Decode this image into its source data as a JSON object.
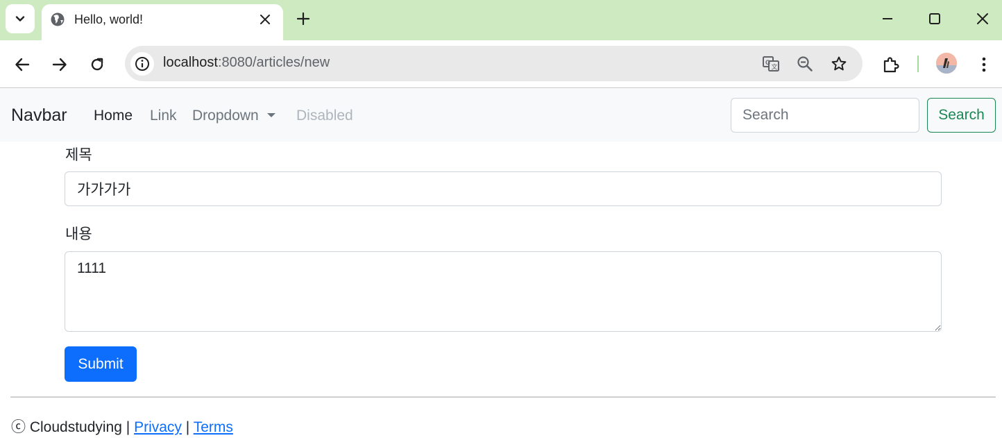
{
  "browser": {
    "tab": {
      "title": "Hello, world!"
    },
    "url": {
      "host": "localhost",
      "path": ":8080/articles/new"
    },
    "icons": [
      "tab-search-icon",
      "globe-icon",
      "close-icon",
      "plus-icon",
      "minimize-icon",
      "maximize-icon",
      "window-close-icon",
      "back-arrow-icon",
      "forward-arrow-icon",
      "reload-icon",
      "site-info-icon",
      "translate-icon",
      "zoom-out-icon",
      "bookmark-star-icon",
      "extensions-icon",
      "profile-avatar",
      "more-menu-icon"
    ]
  },
  "navbar": {
    "brand": "Navbar",
    "items": [
      {
        "label": "Home",
        "state": "active"
      },
      {
        "label": "Link",
        "state": "normal"
      },
      {
        "label": "Dropdown",
        "state": "dropdown"
      },
      {
        "label": "Disabled",
        "state": "disabled"
      }
    ],
    "search": {
      "placeholder": "Search",
      "button_label": "Search"
    }
  },
  "form": {
    "title_label": "제목",
    "title_value": "가가가가",
    "content_label": "내용",
    "content_value": "1111",
    "submit_label": "Submit"
  },
  "footer": {
    "copyright": "ⓒ Cloudstudying",
    "separator": "|",
    "privacy_label": "Privacy",
    "terms_label": "Terms"
  },
  "colors": {
    "tabbar_bg": "#cdeac0",
    "navbar_bg": "#f8f9fa",
    "primary": "#0d6efd",
    "success": "#198754",
    "disabled": "#adb5bd"
  }
}
